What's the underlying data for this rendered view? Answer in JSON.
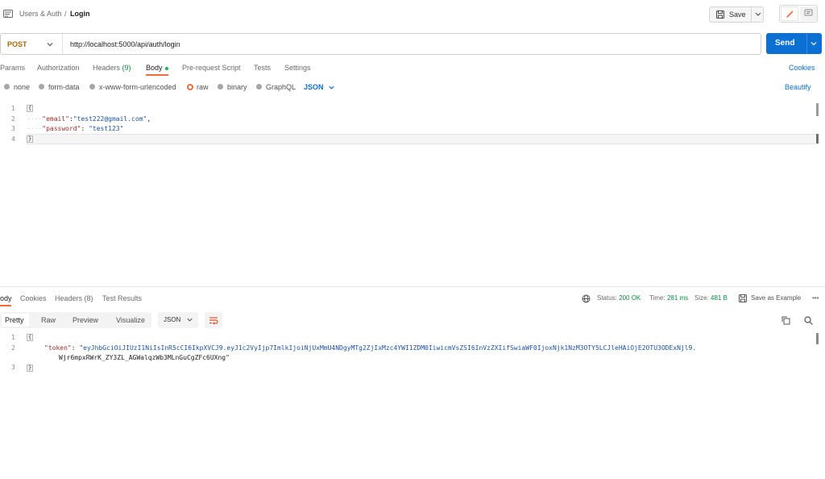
{
  "header": {
    "breadcrumb_parent": "Users & Auth",
    "breadcrumb_sep": "/",
    "breadcrumb_current": "Login",
    "save_label": "Save"
  },
  "request": {
    "method": "POST",
    "url": "http://localhost:5000/api/auth/login",
    "send_label": "Send"
  },
  "request_tabs": {
    "params": "Params",
    "authorization": "Authorization",
    "headers": "Headers",
    "headers_count": "(9)",
    "body": "Body",
    "prescript": "Pre-request Script",
    "tests": "Tests",
    "settings": "Settings",
    "cookies": "Cookies"
  },
  "body_options": {
    "none": "none",
    "form_data": "form-data",
    "urlencoded": "x-www-form-urlencoded",
    "raw": "raw",
    "binary": "binary",
    "graphql": "GraphQL",
    "format": "JSON",
    "beautify": "Beautify"
  },
  "request_body": {
    "lines": [
      "1",
      "2",
      "3",
      "4"
    ],
    "open_brace": "{",
    "close_brace": "}",
    "email_key": "\"email\"",
    "email_value": "\"test222@gmail.com\"",
    "password_key": "\"password\"",
    "password_value": "\"test123\""
  },
  "response_tabs": {
    "body": "ody",
    "cookies": "Cookies",
    "headers": "Headers (8)",
    "test_results": "Test Results"
  },
  "response_meta": {
    "status_label": "Status:",
    "status_value": "200 OK",
    "time_label": "Time:",
    "time_value": "281 ms",
    "size_label": "Size:",
    "size_value": "481 B",
    "save_example": "Save as Example",
    "more": "•••"
  },
  "response_view": {
    "pretty": "Pretty",
    "raw": "Raw",
    "preview": "Preview",
    "visualize": "Visualize",
    "format": "JSON"
  },
  "response_body": {
    "lines": [
      "1",
      "2",
      "3"
    ],
    "open_brace": "{",
    "close_brace": "}",
    "token_key": "\"token\"",
    "token_value_line1": "\"eyJhbGciOiJIUzI1NiIsInR5cCI6IkpXVCJ9.eyJ1c2VyIjp7ImlkIjoiNjUxMmU4NDgyMTg2ZjIxMzc4YWI1ZDM0IiwicmVsZSI6InVzZXIifSwiaWF0IjoxNjk1NzM3OTY5LCJleHAiOjE2OTU3ODExNjl9.",
    "token_value_line2": "Wjr6mpxRWrK_ZY3ZL_AGWalqzWb3MLnGuCgZFc6UXng\""
  }
}
